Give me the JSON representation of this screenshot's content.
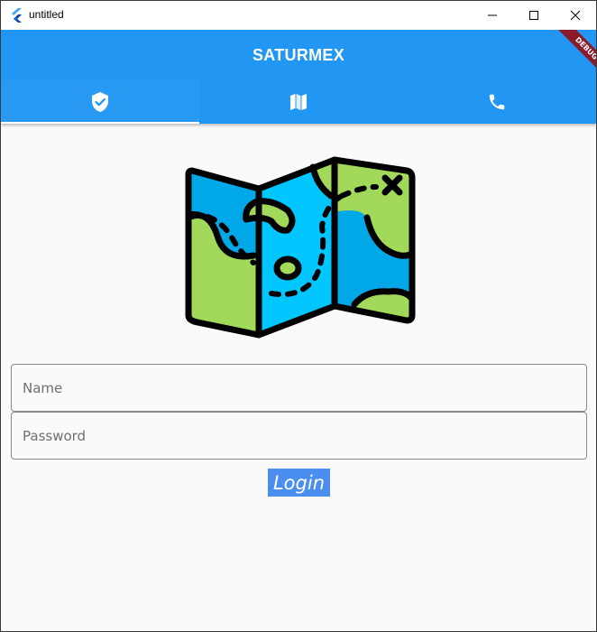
{
  "window": {
    "title": "untitled"
  },
  "appbar": {
    "title": "SATURMEX",
    "tabs": [
      {
        "icon": "shield-check-icon",
        "active": true
      },
      {
        "icon": "map-icon",
        "active": false
      },
      {
        "icon": "phone-icon",
        "active": false
      }
    ]
  },
  "debug_banner": {
    "label": "DEBUG"
  },
  "form": {
    "name_placeholder": "Name",
    "name_value": "",
    "password_placeholder": "Password",
    "password_value": "",
    "login_label": "Login"
  },
  "colors": {
    "primary": "#2196f3",
    "button": "#4a8ef0",
    "banner": "#8b1a2a"
  }
}
